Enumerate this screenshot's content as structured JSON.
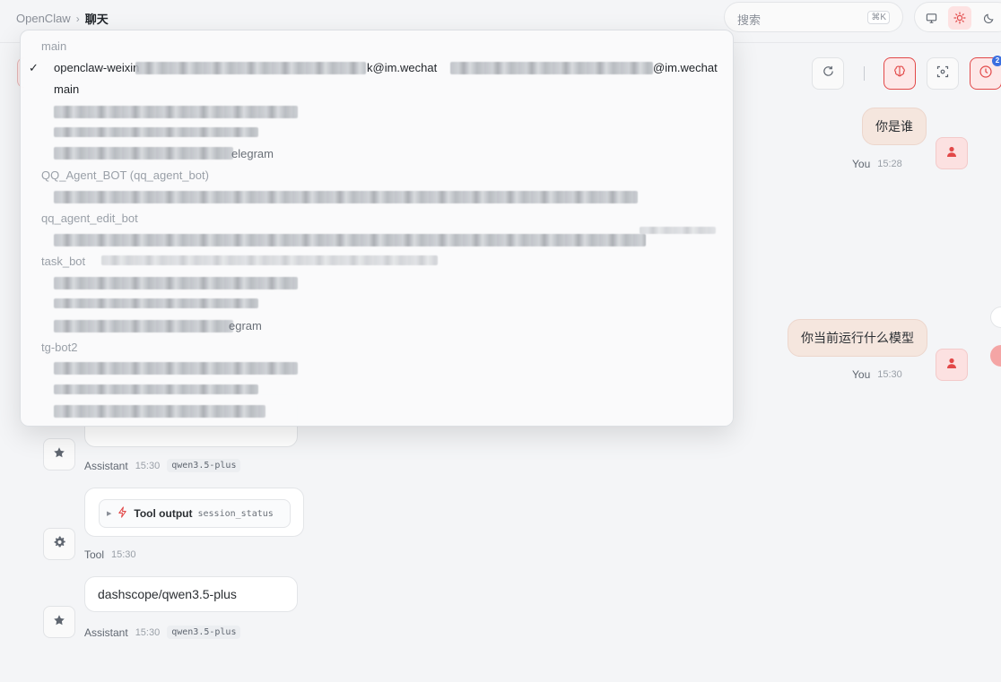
{
  "breadcrumb": {
    "root": "OpenClaw",
    "separator": "›",
    "current": "聊天"
  },
  "search": {
    "placeholder": "搜索",
    "shortcut": "⌘K"
  },
  "toolbar": {
    "notification_count": "2"
  },
  "colors": {
    "accent": "#e24848",
    "user_bubble": "#f5e6de",
    "badge": "#3b6fe0"
  },
  "dropdown": {
    "groups": [
      {
        "label": "main",
        "items": [
          "openclaw-weixin",
          "k@im.wechat",
          "@im.wechat",
          "main"
        ]
      },
      {
        "label": "QQ_Agent_BOT (qq_agent_bot)"
      },
      {
        "label": "qq_agent_edit_bot"
      },
      {
        "label": "task_bot"
      },
      {
        "label": "tg-bot2"
      }
    ],
    "selected_check": "✓",
    "partial_text": {
      "telegram_tail_1": "elegram",
      "telegram_tail_2": "egram"
    }
  },
  "messages": [
    {
      "role": "user",
      "text": "你是谁",
      "sender": "You",
      "time": "15:28"
    },
    {
      "role": "user",
      "text": "你当前运行什么模型",
      "sender": "You",
      "time": "15:30"
    },
    {
      "role": "assistant",
      "sender": "Assistant",
      "time": "15:30",
      "model": "qwen3.5-plus"
    },
    {
      "role": "tool",
      "sender": "Tool",
      "time": "15:30",
      "tool_label": "Tool output",
      "tool_name": "session_status"
    },
    {
      "role": "assistant",
      "text": "dashscope/qwen3.5-plus",
      "sender": "Assistant",
      "time": "15:30",
      "model": "qwen3.5-plus"
    }
  ],
  "icons": [
    "refresh-icon",
    "brain-icon",
    "focus-icon",
    "clock-icon",
    "monitor-icon",
    "sun-icon",
    "moon-icon",
    "user-icon",
    "star-icon",
    "gear-icon",
    "spark-icon"
  ]
}
